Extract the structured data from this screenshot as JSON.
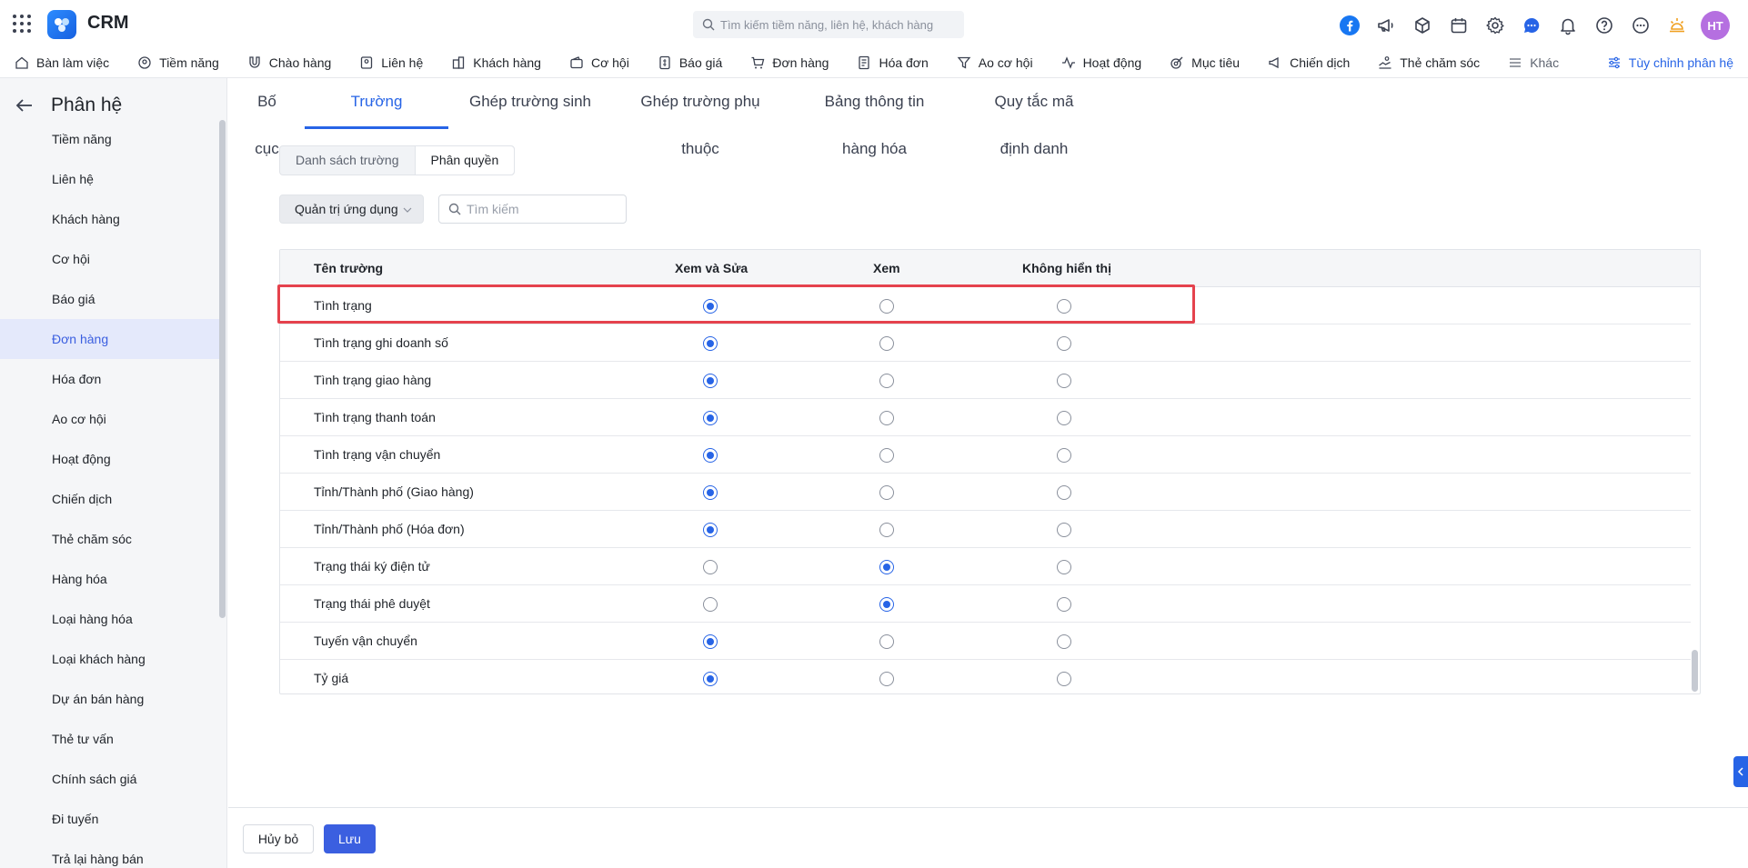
{
  "app": {
    "title": "CRM"
  },
  "search": {
    "placeholder": "Tìm kiếm tiềm năng, liên hệ, khách hàng"
  },
  "user": {
    "initials": "HT"
  },
  "modules": [
    {
      "label": "Bàn làm việc",
      "icon": "home-icon"
    },
    {
      "label": "Tiềm năng",
      "icon": "target-user-icon"
    },
    {
      "label": "Chào hàng",
      "icon": "magnet-icon"
    },
    {
      "label": "Liên hệ",
      "icon": "contact-icon"
    },
    {
      "label": "Khách hàng",
      "icon": "building-icon"
    },
    {
      "label": "Cơ hội",
      "icon": "wallet-icon"
    },
    {
      "label": "Báo giá",
      "icon": "quote-icon"
    },
    {
      "label": "Đơn hàng",
      "icon": "cart-icon"
    },
    {
      "label": "Hóa đơn",
      "icon": "invoice-icon"
    },
    {
      "label": "Ao cơ hội",
      "icon": "funnel-icon"
    },
    {
      "label": "Hoạt động",
      "icon": "activity-icon"
    },
    {
      "label": "Mục tiêu",
      "icon": "goal-icon"
    },
    {
      "label": "Chiến dịch",
      "icon": "megaphone-icon"
    },
    {
      "label": "Thẻ chăm sóc",
      "icon": "care-icon"
    }
  ],
  "more_label": "Khác",
  "customize_label": "Tùy chỉnh phân hệ",
  "sidebar": {
    "title": "Phân hệ",
    "items": [
      "Tiềm năng",
      "Liên hệ",
      "Khách hàng",
      "Cơ hội",
      "Báo giá",
      "Đơn hàng",
      "Hóa đơn",
      "Ao cơ hội",
      "Hoạt động",
      "Chiến dịch",
      "Thẻ chăm sóc",
      "Hàng hóa",
      "Loại hàng hóa",
      "Loại khách hàng",
      "Dự án bán hàng",
      "Thẻ tư vấn",
      "Chính sách giá",
      "Đi tuyến",
      "Trả lại hàng bán"
    ],
    "active_index": 5
  },
  "tabs": [
    "Bố cục",
    "Trường",
    "Ghép trường sinh",
    "Ghép trường phụ thuộc",
    "Bảng thông tin hàng hóa",
    "Quy tắc mã định danh"
  ],
  "active_tab": 1,
  "segment": {
    "list_label": "Danh sách trường",
    "perm_label": "Phân quyền"
  },
  "role_select": {
    "value": "Quản trị ứng dụng"
  },
  "filter": {
    "placeholder": "Tìm kiếm"
  },
  "table": {
    "headers": {
      "name": "Tên trường",
      "edit": "Xem và Sửa",
      "view": "Xem",
      "hidden": "Không hiển thị"
    },
    "rows": [
      {
        "name": "Tình trạng",
        "perm": "edit"
      },
      {
        "name": "Tình trạng ghi doanh số",
        "perm": "edit"
      },
      {
        "name": "Tình trạng giao hàng",
        "perm": "edit"
      },
      {
        "name": "Tình trạng thanh toán",
        "perm": "edit"
      },
      {
        "name": "Tình trạng vận chuyển",
        "perm": "edit"
      },
      {
        "name": "Tỉnh/Thành phố (Giao hàng)",
        "perm": "edit"
      },
      {
        "name": "Tỉnh/Thành phố (Hóa đơn)",
        "perm": "edit"
      },
      {
        "name": "Trạng thái ký điện tử",
        "perm": "view"
      },
      {
        "name": "Trạng thái phê duyệt",
        "perm": "view"
      },
      {
        "name": "Tuyến vận chuyển",
        "perm": "edit"
      },
      {
        "name": "Tỷ giá",
        "perm": "edit"
      }
    ]
  },
  "footer": {
    "cancel_label": "Hủy bỏ",
    "save_label": "Lưu"
  },
  "colors": {
    "accent": "#2764e6",
    "highlight": "#e5424d",
    "avatar": "#b56fe0"
  }
}
